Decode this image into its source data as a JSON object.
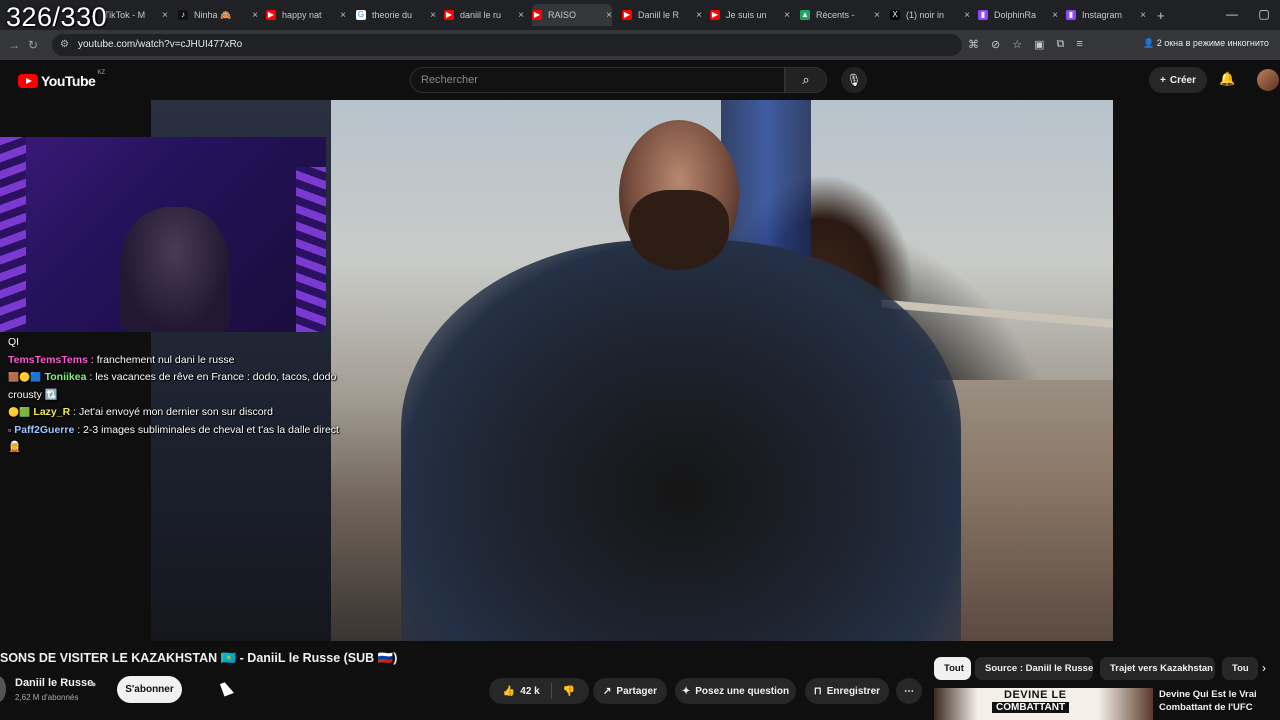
{
  "overlay": {
    "counter": "326/330"
  },
  "browser": {
    "tabs": [
      {
        "label": "TikTok - M",
        "favicon": "tiktok-icon",
        "color": "#111111",
        "glyph": "♪"
      },
      {
        "label": "Ninha 🙈",
        "favicon": "tiktok-icon",
        "color": "#111111",
        "glyph": "♪"
      },
      {
        "label": "happy nat",
        "favicon": "youtube-icon",
        "color": "#ff0000",
        "glyph": "▶"
      },
      {
        "label": "theorie du",
        "favicon": "google-icon",
        "color": "#ffffff",
        "glyph": "G"
      },
      {
        "label": "daniil le ru",
        "favicon": "youtube-icon",
        "color": "#ff0000",
        "glyph": "▶"
      },
      {
        "label": "RAISO",
        "favicon": "youtube-icon",
        "color": "#ff0000",
        "glyph": "▶"
      },
      {
        "label": "Daniil le R",
        "favicon": "youtube-icon",
        "color": "#ff0000",
        "glyph": "▶"
      },
      {
        "label": "Je suis un",
        "favicon": "youtube-icon",
        "color": "#ff0000",
        "glyph": "▶"
      },
      {
        "label": "Récents -",
        "favicon": "drive-icon",
        "color": "#1fa463",
        "glyph": "▲"
      },
      {
        "label": "(1) noir in",
        "favicon": "x-icon",
        "color": "#000000",
        "glyph": "X"
      },
      {
        "label": "DolphinRa",
        "favicon": "twitch-icon",
        "color": "#9146ff",
        "glyph": "▮"
      },
      {
        "label": "Instagram",
        "favicon": "twitch-icon",
        "color": "#9146ff",
        "glyph": "▮"
      }
    ],
    "url": "youtube.com/watch?v=cJHUI477xRo",
    "incognito": "2 окна в режиме инкогнито"
  },
  "youtube": {
    "logo": "YouTube",
    "country": "KZ",
    "search_placeholder": "Rechercher",
    "create_label": "Créer"
  },
  "stream_chat": [
    {
      "user": "",
      "user_color": "#ffffff",
      "badges": "",
      "text": "QI"
    },
    {
      "user": "TemsTemsTems",
      "user_color": "#ff5ad6",
      "badges": "",
      "text": "franchement nul dani le russe"
    },
    {
      "user": "Toniikea",
      "user_color": "#7cf77c",
      "badges": "🟫🟡🟦",
      "text": "les vacances de rêve en France : dodo, tacos, dodo crousty 🔃"
    },
    {
      "user": "Lazy_R",
      "user_color": "#f2e94e",
      "badges": "🟡🟩",
      "text": "Jet'ai envoyé mon dernier son sur discord"
    },
    {
      "user": "Paff2Guerre",
      "user_color": "#9ec8ff",
      "badges": "▫",
      "text": "2-3 images subliminales de cheval et t'as la dalle direct 🧝"
    }
  ],
  "video": {
    "title": "SONS DE VISITER LE KAZAKHSTAN 🇰🇿 - DaniiL le Russe (SUB 🇷🇺)",
    "channel": "Daniil le Russe",
    "subscribers": "2,62 M d'abonnés",
    "subscribe_label": "S'abonner",
    "likes": "42 k",
    "share_label": "Partager",
    "ask_label": "Posez une question",
    "save_label": "Enregistrer"
  },
  "chips": [
    "Tout",
    "Source : Daniil le Russe",
    "Trajet vers Kazakhstan",
    "Tou"
  ],
  "recommendation": {
    "thumb_text_1": "DEVINE LE",
    "thumb_text_2": "COMBATTANT",
    "title": "Devine Qui Est le Vrai Combattant de l'UFC"
  }
}
